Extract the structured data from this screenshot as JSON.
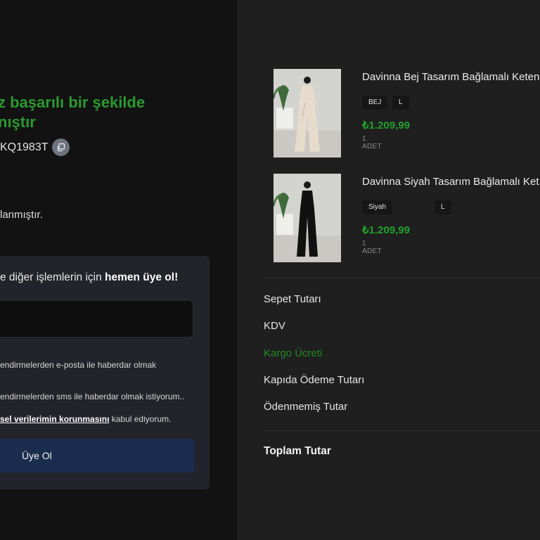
{
  "confirmation": {
    "title_line1": "z başarılı bir şekilde",
    "title_line2": "nıştır",
    "order_code": "KQ1983T",
    "info_text": "lanmıştır."
  },
  "signup": {
    "heading_prefix": "e diğer işlemlerin için ",
    "heading_bold": "hemen üye ol!",
    "email_consent_line1": "endirmelerden e-posta ile haberdar olmak",
    "sms_consent": "endirmelerden sms ile haberdar olmak istiyorum..",
    "kvkk_link": "sel verilerimin korunmasını",
    "kvkk_suffix": " kabul ediyorum.",
    "submit_label": "Üye Ol"
  },
  "cart": {
    "items": [
      {
        "name": "Davinna Bej Tasarım Bağlamalı Keten",
        "color": "BEJ",
        "size": "L",
        "price": "₺1.209,99",
        "qty": "1 ADET",
        "outfit_color": "#e7dccb"
      },
      {
        "name": "Davinna Siyah Tasarım Bağlamalı Ket",
        "color": "Siyah",
        "size": "L",
        "price": "₺1.209,99",
        "qty": "1 ADET",
        "outfit_color": "#111111"
      }
    ]
  },
  "summary": {
    "subtotal_label": "Sepet Tutarı",
    "tax_label": "KDV",
    "shipping_label": "Kargo Ücreti",
    "cod_label": "Kapıda Ödeme Tutarı",
    "unpaid_label": "Ödenmemiş Tutar",
    "total_label": "Toplam Tutar"
  },
  "colors": {
    "success_green": "#2b9a2f",
    "price_green": "#21a02b",
    "button_navy": "#1b2d4e",
    "left_bg": "#121212",
    "right_bg": "#1f1f1f"
  }
}
